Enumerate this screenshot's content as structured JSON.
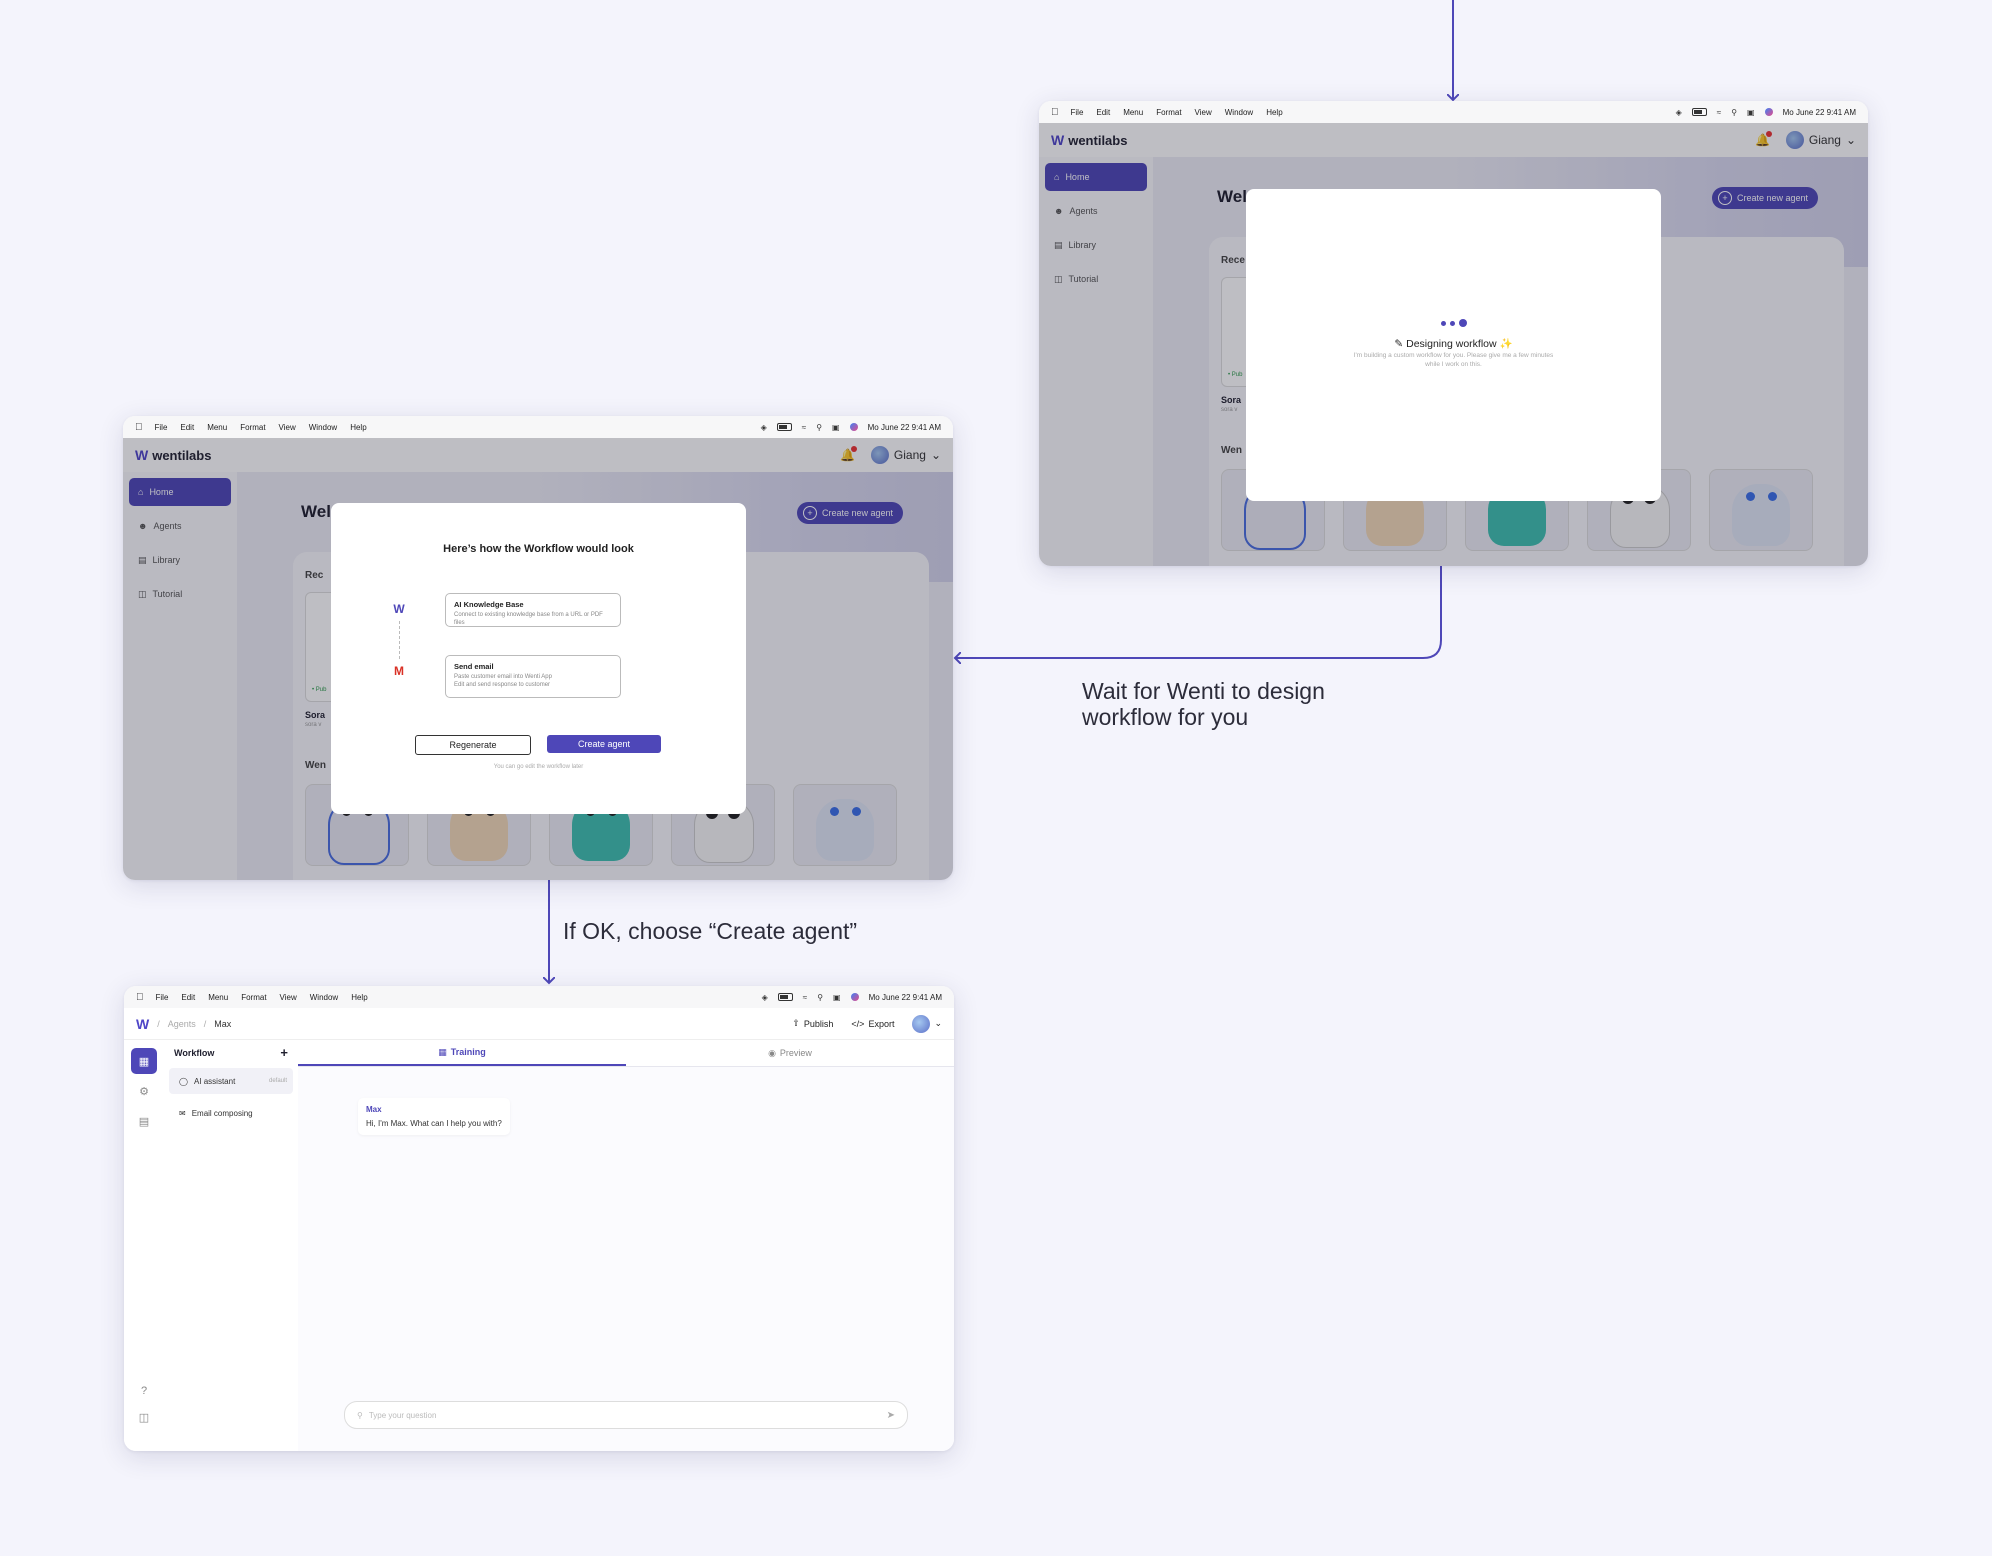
{
  "menubar": {
    "items": [
      "File",
      "Edit",
      "Menu",
      "Format",
      "View",
      "Window",
      "Help"
    ],
    "datetime": "Mo June 22  9:41 AM"
  },
  "app": {
    "brand": "wentilabs",
    "user": "Giang",
    "sidebar": [
      "Home",
      "Agents",
      "Library",
      "Tutorial"
    ],
    "welcome": "Wel",
    "welcome_small": "We",
    "create_button": "Create new agent",
    "recent_label": "Rece",
    "recent_label_small": "Rec",
    "card_name": "Sora",
    "card_sub": "sora v",
    "card_status": "• Pub",
    "wenti_label": "Wen"
  },
  "screen_designing": {
    "title": "Designing workflow",
    "title_icon_left": "✎",
    "title_icon_right": "✨",
    "subtitle": "I'm building a custom workflow for you. Please give me a few minutes while I work on this."
  },
  "screen_workflow": {
    "title": "Here’s how the Workflow would look",
    "steps": [
      {
        "title": "AI Knowledge Base",
        "desc": "Connect to existing knowledge base from a URL or PDF files"
      },
      {
        "title": "Send email",
        "desc": "Paste customer email into Wenti App\nEdit and send response to customer"
      }
    ],
    "regenerate": "Regenerate",
    "create": "Create agent",
    "note": "You can go edit the workflow later"
  },
  "screen_agent": {
    "breadcrumb": [
      "Agents",
      "Max"
    ],
    "publish": "Publish",
    "export": "Export",
    "workflow_label": "Workflow",
    "workflow_items": [
      {
        "label": "AI assistant",
        "badge": "default"
      },
      {
        "label": "Email composing",
        "badge": ""
      }
    ],
    "tabs": [
      "Training",
      "Preview"
    ],
    "bot_name": "Max",
    "bot_message": "Hi, I'm Max. What can I help you with?",
    "input_placeholder": "Type your question"
  },
  "captions": {
    "wait": "Wait for Wenti to design\nworkflow for you",
    "ok": "If OK, choose “Create agent”"
  },
  "colors": {
    "accent": "#4e47b8",
    "arrow": "#4e47b8",
    "background": "#f4f4fc"
  }
}
